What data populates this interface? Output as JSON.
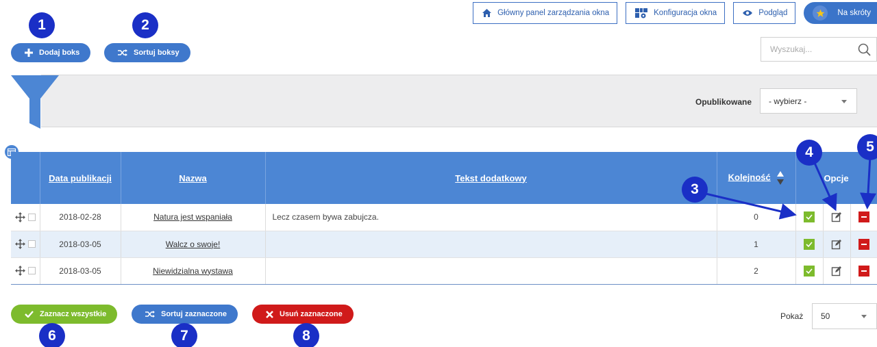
{
  "toolbar": {
    "main_panel": "Główny panel zarządzania okna",
    "config": "Konfiguracja okna",
    "preview": "Podgląd",
    "shortcuts": "Na skróty"
  },
  "actions": {
    "add_box": "Dodaj boks",
    "sort_boxes": "Sortuj boksy"
  },
  "search": {
    "placeholder": "Wyszukaj..."
  },
  "filter": {
    "published_label": "Opublikowane",
    "published_value": "- wybierz -"
  },
  "table": {
    "headers": {
      "date": "Data publikacji",
      "name": "Nazwa",
      "extra": "Tekst dodatkowy",
      "order": "Kolejność",
      "options": "Opcje"
    },
    "rows": [
      {
        "date": "2018-02-28",
        "name": "Natura jest wspaniała",
        "extra": "Lecz czasem bywa zabujcza.",
        "order": "0"
      },
      {
        "date": "2018-03-05",
        "name": "Walcz o swoje!",
        "extra": "",
        "order": "1"
      },
      {
        "date": "2018-03-05",
        "name": "Niewidzialna wystawa",
        "extra": "",
        "order": "2"
      }
    ]
  },
  "bottom_actions": {
    "select_all": "Zaznacz wszystkie",
    "sort_selected": "Sortuj zaznaczone",
    "delete_selected": "Usuń zaznaczone"
  },
  "pagination": {
    "show_label": "Pokaż",
    "per_page": "50"
  },
  "markers": [
    "1",
    "2",
    "3",
    "4",
    "5",
    "6",
    "7",
    "8"
  ],
  "colors": {
    "accent_blue": "#3f78cc",
    "header_blue": "#4c86d4",
    "green": "#7dbb2d",
    "red": "#d01a1a",
    "marker": "#1a2fc6"
  }
}
